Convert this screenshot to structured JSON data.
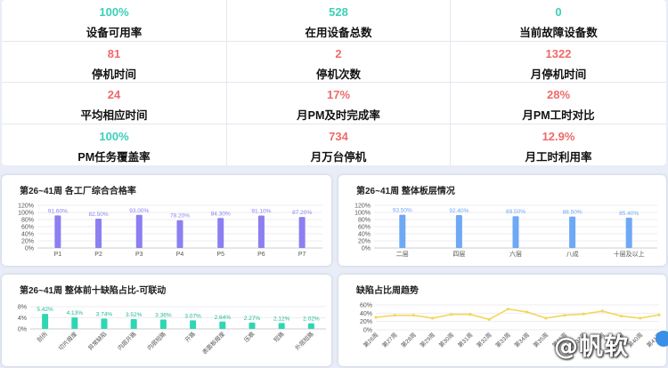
{
  "kpis": [
    {
      "value": "100%",
      "label": "设备可用率",
      "color": "#3ccfb8"
    },
    {
      "value": "528",
      "label": "在用设备总数",
      "color": "#3ccfb8"
    },
    {
      "value": "0",
      "label": "当前故障设备数",
      "color": "#3ccfb8"
    },
    {
      "value": "81",
      "label": "停机时间",
      "color": "#ef6a6a"
    },
    {
      "value": "2",
      "label": "停机次数",
      "color": "#ef6a6a"
    },
    {
      "value": "1322",
      "label": "月停机时间",
      "color": "#ef6a6a"
    },
    {
      "value": "24",
      "label": "平均相应时间",
      "color": "#ef6a6a"
    },
    {
      "value": "17%",
      "label": "月PM及时完成率",
      "color": "#ef6a6a"
    },
    {
      "value": "28%",
      "label": "月PM工时对比",
      "color": "#ef6a6a"
    },
    {
      "value": "100%",
      "label": "PM任务覆盖率",
      "color": "#3ccfb8"
    },
    {
      "value": "734",
      "label": "月万台停机",
      "color": "#ef6a6a"
    },
    {
      "value": "12.9%",
      "label": "月工时利用率",
      "color": "#ef6a6a"
    }
  ],
  "chart_data": [
    {
      "type": "bar",
      "title": "第26~41周 各工厂综合合格率",
      "categories": [
        "P1",
        "P2",
        "P3",
        "P4",
        "P5",
        "P6",
        "P7"
      ],
      "values": [
        91.6,
        82.5,
        93.0,
        78.2,
        84.3,
        91.1,
        87.2
      ],
      "data_labels": [
        "91.60%",
        "82.50%",
        "93.00%",
        "78.20%",
        "84.30%",
        "91.10%",
        "87.20%"
      ],
      "yticks": [
        "0%",
        "20%",
        "40%",
        "60%",
        "80%",
        "100%",
        "120%"
      ],
      "ylim": [
        0,
        120
      ],
      "color": "#8b7ff2",
      "label_color": "#8b7ff2"
    },
    {
      "type": "bar",
      "title": "第26~41周 整体板层情况",
      "categories": [
        "二层",
        "四层",
        "六层",
        "八成",
        "十层及以上"
      ],
      "values": [
        93.5,
        92.4,
        89.5,
        88.5,
        85.4
      ],
      "data_labels": [
        "93.50%",
        "92.40%",
        "89.50%",
        "88.50%",
        "85.40%"
      ],
      "yticks": [
        "0%",
        "20%",
        "40%",
        "60%",
        "80%",
        "100%",
        "120%"
      ],
      "ylim": [
        0,
        120
      ],
      "color": "#6fa8f5",
      "label_color": "#6fa8f5"
    },
    {
      "type": "bar",
      "title": "第26~41周 整体前十缺陷占比-可联动",
      "categories": [
        "刮伤",
        "切片报废",
        "异常缺陷",
        "内层开路",
        "内层短路",
        "开路",
        "表面板报废",
        "压痕",
        "短路",
        "外层短路"
      ],
      "values": [
        5.42,
        4.13,
        3.74,
        3.52,
        3.36,
        3.07,
        2.64,
        2.27,
        2.12,
        2.02
      ],
      "data_labels": [
        "5.42%",
        "4.13%",
        "3.74%",
        "3.52%",
        "3.36%",
        "3.07%",
        "2.64%",
        "2.27%",
        "2.12%",
        "2.02%"
      ],
      "yticks": [
        "0%",
        "4%",
        "8%"
      ],
      "ylim": [
        0,
        8
      ],
      "color": "#2fd6b2",
      "label_color": "#22b892"
    },
    {
      "type": "line",
      "title": "缺陷占比周趋势",
      "x": [
        "第26周",
        "第27周",
        "第28周",
        "第29周",
        "第30周",
        "第31周",
        "第32周",
        "第33周",
        "第34周",
        "第35周",
        "第36周",
        "第37周",
        "第38周",
        "第39周",
        "第40周",
        "第41周"
      ],
      "values": [
        30,
        35,
        35,
        28,
        37,
        37,
        25,
        50,
        43,
        28,
        35,
        38,
        45,
        33,
        28,
        36
      ],
      "yticks": [
        "0%",
        "20%",
        "40%",
        "60%"
      ],
      "ylim": [
        0,
        60
      ],
      "color": "#f6d55c"
    }
  ]
}
